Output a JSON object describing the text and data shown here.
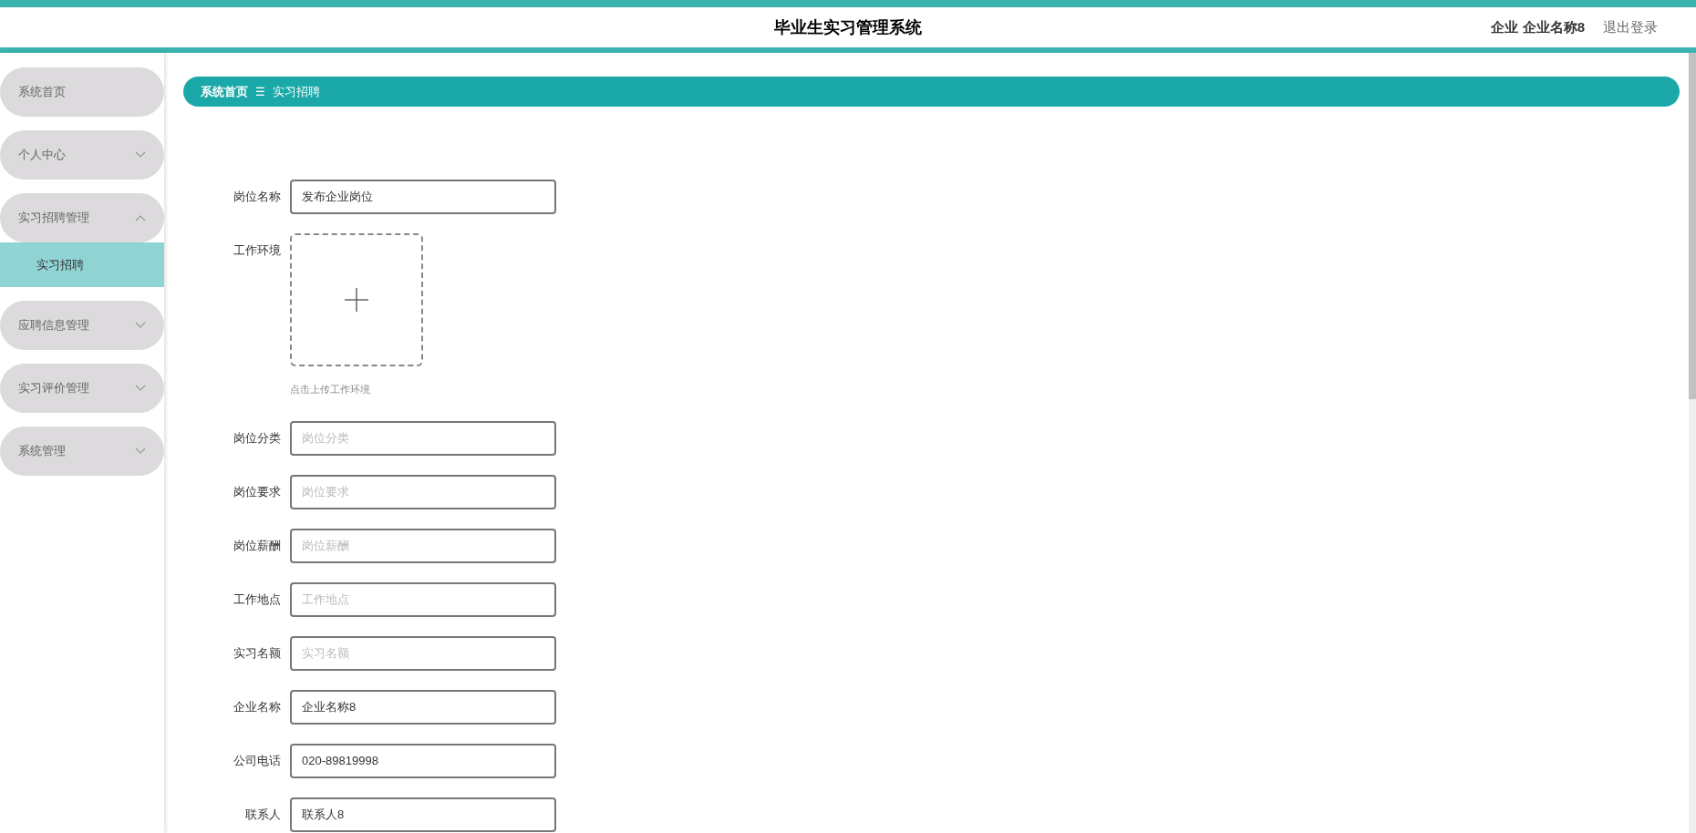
{
  "header": {
    "title": "毕业生实习管理系统",
    "user": "企业 企业名称8",
    "logout": "退出登录"
  },
  "sidebar": {
    "items": [
      {
        "label": "系统首页",
        "kind": "link"
      },
      {
        "label": "个人中心",
        "kind": "menu",
        "expanded": false
      },
      {
        "label": "实习招聘管理",
        "kind": "menu",
        "expanded": true,
        "children": [
          {
            "label": "实习招聘",
            "selected": true
          }
        ]
      },
      {
        "label": "应聘信息管理",
        "kind": "menu",
        "expanded": false
      },
      {
        "label": "实习评价管理",
        "kind": "menu",
        "expanded": false
      },
      {
        "label": "系统管理",
        "kind": "menu",
        "expanded": false
      }
    ]
  },
  "breadcrumb": {
    "items": [
      "系统首页",
      "实习招聘"
    ],
    "separator": "☰"
  },
  "form": {
    "fields": [
      {
        "label": "岗位名称",
        "kind": "text",
        "value": "发布企业岗位"
      },
      {
        "label": "工作环境",
        "kind": "upload",
        "hint": "点击上传工作环境"
      },
      {
        "label": "岗位分类",
        "kind": "text",
        "placeholder": "岗位分类"
      },
      {
        "label": "岗位要求",
        "kind": "text",
        "placeholder": "岗位要求"
      },
      {
        "label": "岗位薪酬",
        "kind": "text",
        "placeholder": "岗位薪酬"
      },
      {
        "label": "工作地点",
        "kind": "text",
        "placeholder": "工作地点"
      },
      {
        "label": "实习名额",
        "kind": "text",
        "placeholder": "实习名额"
      },
      {
        "label": "企业名称",
        "kind": "text",
        "value": "企业名称8"
      },
      {
        "label": "公司电话",
        "kind": "text",
        "value": "020-89819998"
      },
      {
        "label": "联系人",
        "kind": "text",
        "value": "联系人8"
      }
    ]
  }
}
